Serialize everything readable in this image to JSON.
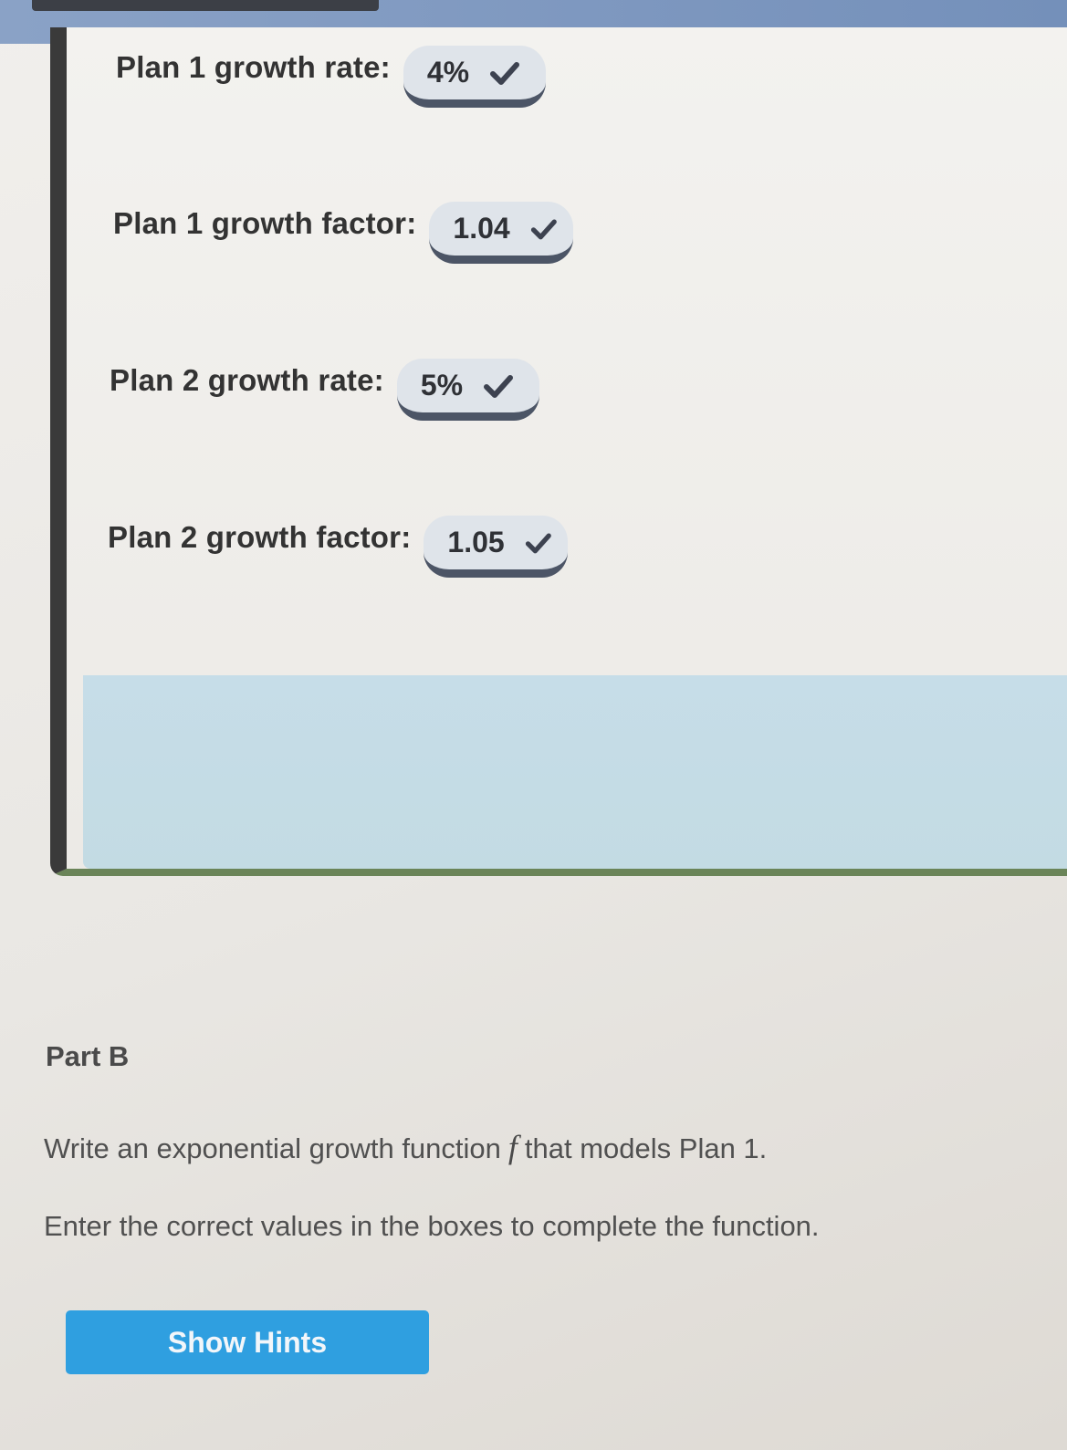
{
  "growth_table": {
    "rows": [
      {
        "label": "Plan 1 growth rate:",
        "value": "4%"
      },
      {
        "label": "Plan 1 growth factor:",
        "value": "1.04"
      },
      {
        "label": "Plan 2 growth rate:",
        "value": "5%"
      },
      {
        "label": "Plan 2 growth factor:",
        "value": "1.05"
      }
    ],
    "status_icon": "checkmark-icon"
  },
  "part_b": {
    "heading": "Part B",
    "prompt_before": "Write an exponential growth function",
    "function_symbol": "f",
    "prompt_after": "that models Plan 1.",
    "instruction": "Enter the correct values in the boxes to complete the function."
  },
  "hints_button": {
    "label": "Show Hints"
  },
  "colors": {
    "accent": "#2f9fe0",
    "card_border": "#6a8458",
    "answer_box": "#dfe4ea"
  }
}
